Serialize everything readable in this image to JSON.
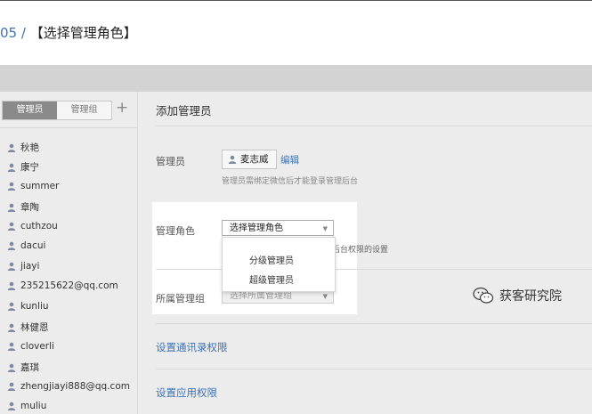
{
  "step": {
    "number": "05 /",
    "title": "【选择管理角色】"
  },
  "sidebar": {
    "tabs": [
      {
        "label": "管理员",
        "active": true
      },
      {
        "label": "管理组",
        "active": false
      }
    ],
    "add_symbol": "+",
    "users": [
      "秋艳",
      "康宁",
      "summer",
      "章陶",
      "cuthzou",
      "dacui",
      "jiayi",
      "235215622@qq.com",
      "kunliu",
      "林健恩",
      "cloverli",
      "嘉琪",
      "zhengjiayi888@qq.com",
      "muliu"
    ]
  },
  "main": {
    "title": "添加管理员",
    "admin_label": "管理员",
    "admin_name": "麦志威",
    "edit_link": "编辑",
    "admin_hint": "管理员需绑定微信后才能登录管理后台",
    "role_label": "管理角色",
    "role_select_value": "选择管理角色",
    "role_hint_partial": "后台权限的设置",
    "role_options": [
      "分级管理员",
      "超级管理员"
    ],
    "group_label": "所属管理组",
    "group_select_value": "选择所属管理组",
    "contacts_link": "设置通讯录权限",
    "apps_link": "设置应用权限"
  },
  "watermark": {
    "text": "获客研究院",
    "icon": "wechat-logo-icon"
  },
  "colors": {
    "accent": "#3b73b9",
    "tab_active": "#8a8a8a",
    "panel_bg": "#ececec"
  }
}
